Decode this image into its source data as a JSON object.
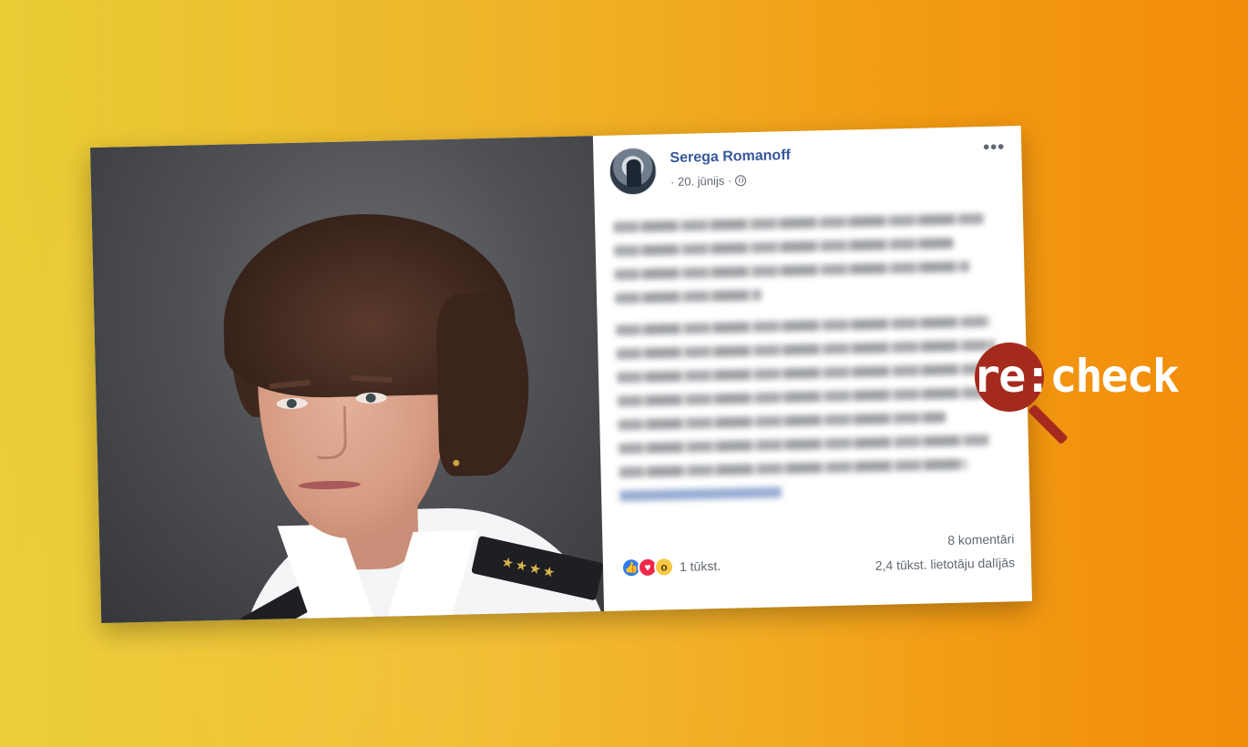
{
  "post": {
    "author": "Serega Romanoff",
    "date": "· 20. jūnijs ·",
    "privacy_icon": "globe-icon",
    "more_icon": "more-dots-icon",
    "more_label": "•••",
    "text_state": "blurred",
    "reactions": {
      "icons": [
        "like-icon",
        "love-icon",
        "wow-icon"
      ],
      "count": "1 tūkst."
    },
    "comments": "8 komentāri",
    "shares": "2,4 tūkst. lietotāju dalījās"
  },
  "logo": {
    "text": "re:check"
  },
  "colors": {
    "author_link": "#365899",
    "meta_text": "#616770",
    "like": "#2f7cf6",
    "love": "#f0284a",
    "wow": "#f7c844",
    "logo_red": "#a52a1e",
    "background_start": "#e8cc36",
    "background_end": "#f28c0b"
  }
}
